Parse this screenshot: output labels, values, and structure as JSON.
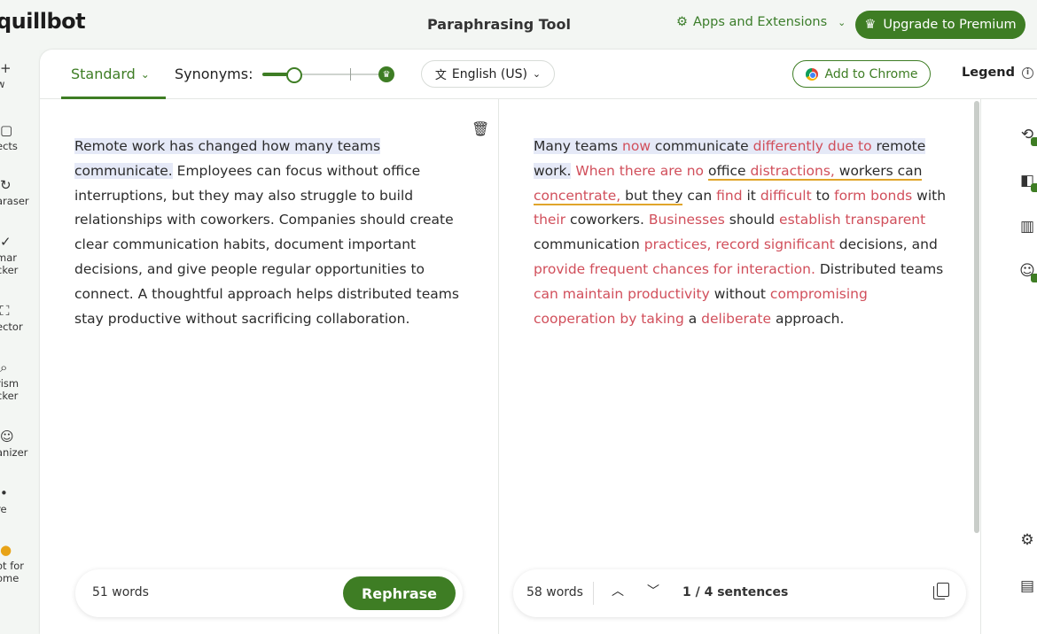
{
  "header": {
    "logo": "quillbot",
    "title": "Paraphrasing Tool",
    "apps_label": "Apps and Extensions",
    "premium_label": "Upgrade to Premium"
  },
  "leftnav": {
    "items": [
      {
        "icon": "plus-icon",
        "glyph": "+",
        "label": "w"
      },
      {
        "icon": "projects-icon",
        "glyph": "▢",
        "label": "ects"
      },
      {
        "icon": "paraphraser-icon",
        "glyph": "↻",
        "label": "araser"
      },
      {
        "icon": "grammar-checker-icon",
        "glyph": "✓",
        "label": "mar",
        "label2": "cker"
      },
      {
        "icon": "ai-detector-icon",
        "glyph": "⛶",
        "label": "ector"
      },
      {
        "icon": "plagiarism-checker-icon",
        "glyph": "⌕",
        "label": "rism",
        "label2": "cker"
      },
      {
        "icon": "humanizer-icon",
        "glyph": "☺",
        "label": "anizer"
      },
      {
        "icon": "more-icon",
        "glyph": "•",
        "label": "re"
      },
      {
        "icon": "chrome-icon",
        "glyph": "●",
        "label": "ot for",
        "label2": "ome"
      }
    ]
  },
  "toolbar": {
    "mode": "Standard",
    "synonyms_label": "Synonyms:",
    "synonyms_level": 0.36,
    "language": "English (US)",
    "add_chrome": "Add to Chrome",
    "legend": "Legend"
  },
  "input": {
    "sentences": [
      "Remote work has changed how many teams communicate.",
      "Employees can focus without office interruptions, but they may also struggle to build relationships with coworkers.",
      "Companies should create clear communication habits, document important decisions, and give people regular opportunities to connect.",
      "A thoughtful approach helps distributed teams stay productive without sacrificing collaboration."
    ],
    "word_count": "51 words",
    "rephrase_label": "Rephrase"
  },
  "output": {
    "segments": [
      {
        "t": "Many teams ",
        "c": 0,
        "h": 1
      },
      {
        "t": "now",
        "c": 1,
        "h": 1
      },
      {
        "t": " communicate ",
        "c": 0,
        "h": 1
      },
      {
        "t": "differently due to",
        "c": 1,
        "h": 1
      },
      {
        "t": " remote work.",
        "c": 0,
        "h": 1
      },
      {
        "t": " ",
        "c": 0
      },
      {
        "t": "When there are no",
        "c": 1
      },
      {
        "t": " ",
        "c": 0
      },
      {
        "t": "office ",
        "c": 0,
        "u": 1
      },
      {
        "t": "distractions,",
        "c": 1,
        "u": 1
      },
      {
        "t": " workers can",
        "c": 0,
        "u": 1
      },
      {
        "t": " ",
        "c": 0
      },
      {
        "t": "concentrate,",
        "c": 1,
        "u": 1
      },
      {
        "t": " but they",
        "c": 0,
        "u": 1
      },
      {
        "t": " can ",
        "c": 0
      },
      {
        "t": "find",
        "c": 1
      },
      {
        "t": " it ",
        "c": 0
      },
      {
        "t": "difficult",
        "c": 1
      },
      {
        "t": " to ",
        "c": 0
      },
      {
        "t": "form bonds",
        "c": 1
      },
      {
        "t": " with ",
        "c": 0
      },
      {
        "t": "their",
        "c": 1
      },
      {
        "t": " coworkers. ",
        "c": 0
      },
      {
        "t": "Businesses",
        "c": 1
      },
      {
        "t": " should ",
        "c": 0
      },
      {
        "t": "establish transparent",
        "c": 1
      },
      {
        "t": " communication ",
        "c": 0
      },
      {
        "t": "practices, record significant",
        "c": 1
      },
      {
        "t": " decisions, and ",
        "c": 0
      },
      {
        "t": "provide frequent chances for interaction.",
        "c": 1
      },
      {
        "t": " Distributed teams ",
        "c": 0
      },
      {
        "t": "can maintain productivity",
        "c": 1
      },
      {
        "t": " without ",
        "c": 0
      },
      {
        "t": "compromising cooperation by taking",
        "c": 1
      },
      {
        "t": " a ",
        "c": 0
      },
      {
        "t": "deliberate",
        "c": 1
      },
      {
        "t": " approach.",
        "c": 0
      }
    ],
    "word_count": "58 words",
    "sentence_position": "1 / 4 sentences"
  },
  "colors": {
    "brand_green": "#3e7d24",
    "changed_word": "#d14f5b",
    "structure_underline": "#e0a52a",
    "sentence_highlight": "#e5e9f7"
  }
}
